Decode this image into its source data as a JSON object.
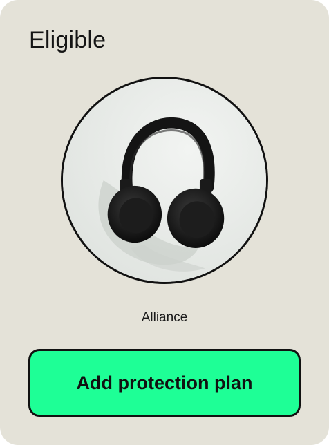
{
  "card": {
    "status_title": "Eligible",
    "product": {
      "name": "Alliance",
      "image_icon": "headphones-icon"
    },
    "cta": {
      "label": "Add protection plan"
    }
  },
  "colors": {
    "card_background": "#e4e2d8",
    "cta_background": "#1eff96",
    "outline": "#111111"
  }
}
